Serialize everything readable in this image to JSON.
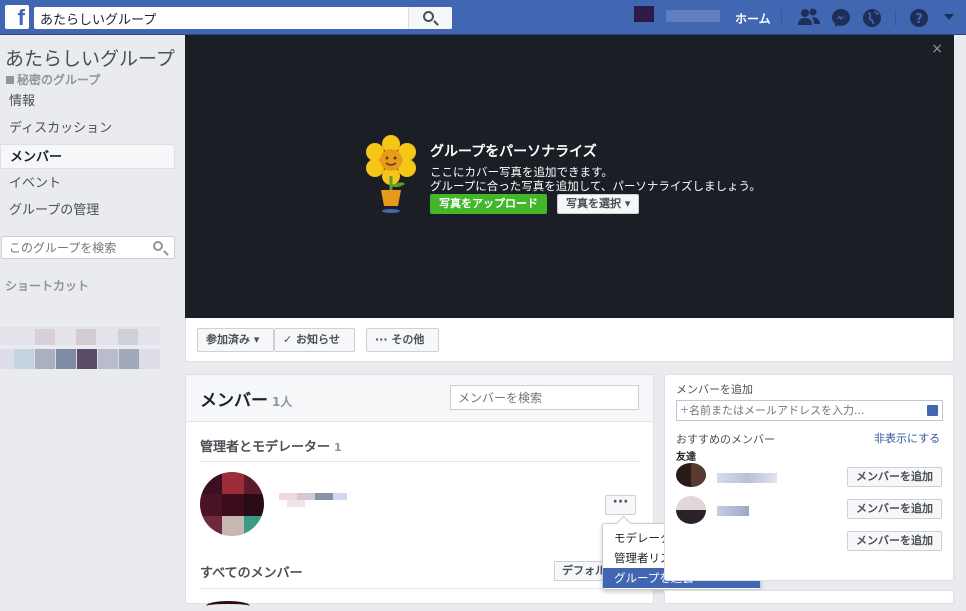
{
  "topbar": {
    "logo": "f",
    "search_value": "あたらしいグループ",
    "home_label": "ホーム",
    "icons": [
      "friends-icon",
      "messenger-icon",
      "globe-icon",
      "help-icon",
      "account-caret-icon"
    ],
    "brand_color": "#4267b2"
  },
  "sidebar": {
    "group_title": "あたらしいグループ",
    "privacy": "秘密のグループ",
    "items": [
      {
        "label": "情報"
      },
      {
        "label": "ディスカッション"
      },
      {
        "label": "メンバー",
        "active": true
      },
      {
        "label": "イベント"
      },
      {
        "label": "グループの管理"
      }
    ],
    "search_placeholder": "このグループを検索",
    "shortcuts_label": "ショートカット"
  },
  "cover": {
    "close": "×",
    "title": "グループをパーソナライズ",
    "line1": "ここにカバー写真を追加できます。",
    "line2": "グループに合った写真を追加して、パーソナライズしましょう。",
    "upload_label": "写真をアップロード",
    "select_label": "写真を選択 ▾"
  },
  "actionbar": {
    "joined": "参加済み ▾",
    "notify": "✓ お知らせ",
    "more": "··· その他"
  },
  "members": {
    "title": "メンバー",
    "count": "1人",
    "search_placeholder": "メンバーを検索",
    "admins_title": "管理者とモデレーター",
    "admins_count": "1",
    "dots": "···",
    "all_title": "すべてのメンバー",
    "default_label": "デフォルト"
  },
  "dropdown": {
    "items": [
      {
        "label": "モデレーターに変更する"
      },
      {
        "label": "管理者リストから削除する"
      },
      {
        "label": "グループを退会",
        "selected": true
      }
    ]
  },
  "add_panel": {
    "label": "メンバーを追加",
    "input_placeholder": "名前またはメールアドレスを入力...",
    "suggested": "おすすめのメンバー",
    "hide": "非表示にする",
    "friends": "友達",
    "add_label": "メンバーを追加"
  }
}
